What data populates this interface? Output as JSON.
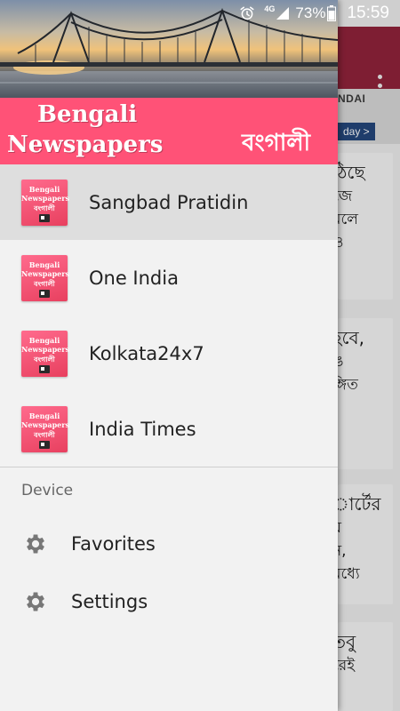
{
  "status_bar": {
    "network": "4G",
    "battery": "73%",
    "time": "15:59",
    "icons": [
      "alarm-icon",
      "signal-icon",
      "battery-icon"
    ]
  },
  "drawer": {
    "header": {
      "title_line1": "Bengali",
      "title_line2": "Newspapers",
      "bengali_title": "বংগালী",
      "banner_color": "#ff5277"
    },
    "items": [
      {
        "label": "Sangbad Pratidin",
        "logo": "app-logo-icon",
        "active": true
      },
      {
        "label": "One India",
        "logo": "app-logo-icon",
        "active": false
      },
      {
        "label": "Kolkata24x7",
        "logo": "app-logo-icon",
        "active": false
      },
      {
        "label": "India Times",
        "logo": "app-logo-icon",
        "active": false
      }
    ],
    "logo_text": {
      "line1": "Bengali",
      "line2": "Newspapers",
      "line3": "বংগালী"
    },
    "section_label": "Device",
    "actions": [
      {
        "label": "Favorites",
        "icon": "gear-icon"
      },
      {
        "label": "Settings",
        "icon": "gear-icon"
      }
    ]
  },
  "background": {
    "toolbar_color": "#7e1e33",
    "ad_brand": "NDAI",
    "ad_button": "day >",
    "cards": [
      {
        "lines": [
          "ঠিছে",
          "",
          "জে",
          "মলে",
          "ও"
        ]
      },
      {
        "lines": [
          "হবে,",
          "",
          "ঙ",
          "ঙ্গিত",
          ","
        ]
      },
      {
        "lines": [
          "ার্টের",
          "য়",
          "ন,",
          "মধ্যে"
        ]
      },
      {
        "lines": [
          "তবু",
          "",
          "রেই"
        ]
      }
    ]
  }
}
